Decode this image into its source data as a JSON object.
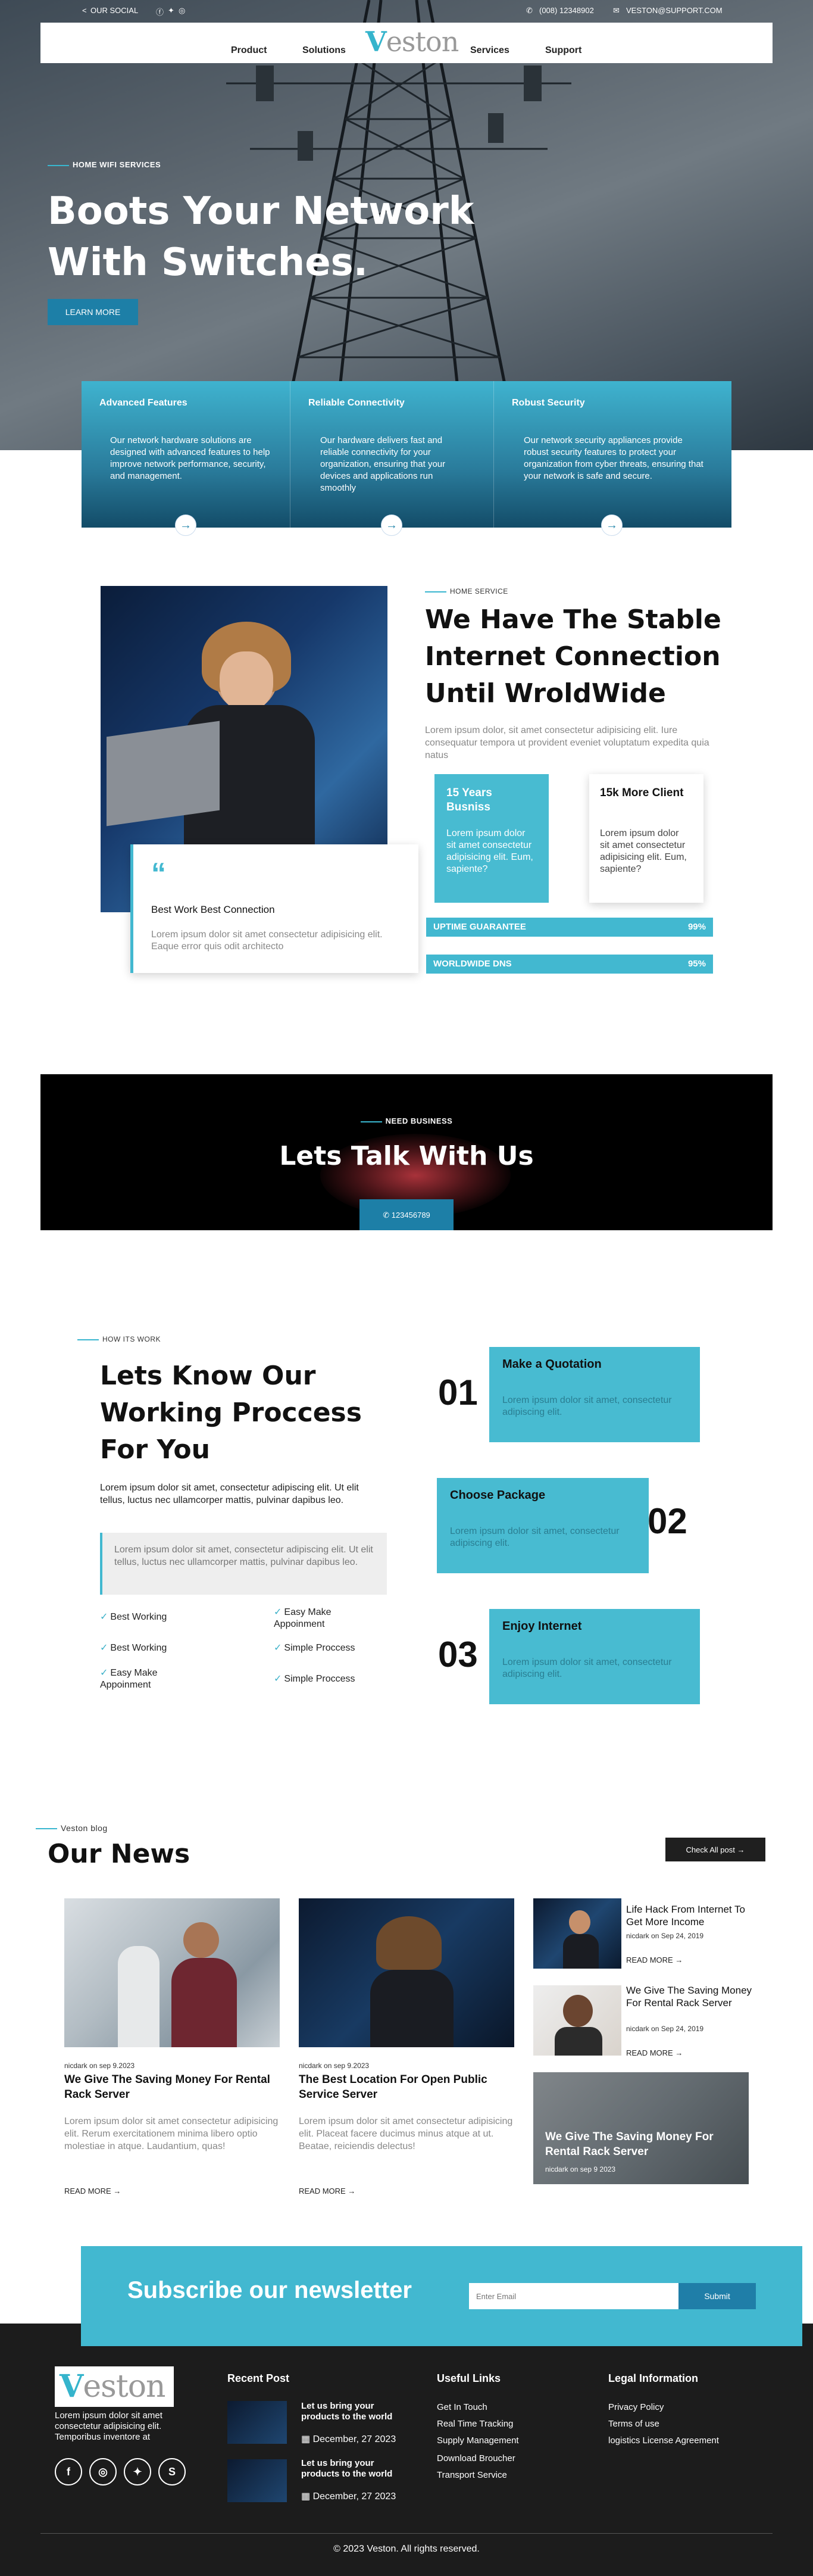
{
  "topbar": {
    "social": "OUR SOCIAL",
    "phone": "(008) 12348902",
    "email": "VESTON@SUPPORT.COM"
  },
  "nav": {
    "logo_first": "V",
    "logo_rest": "eston",
    "items": [
      "Product",
      "Solutions",
      "Services",
      "Support"
    ]
  },
  "hero": {
    "eyebrow": "HOME WIFI SERVICES",
    "title_line1": "Boots Your Network",
    "title_line2": "With Switches.",
    "cta": "LEARN MORE"
  },
  "features": [
    {
      "title": "Advanced Features",
      "text": "Our network hardware solutions are designed with advanced features to help improve network performance, security, and management."
    },
    {
      "title": "Reliable Connectivity",
      "text": "Our hardware delivers fast and reliable connectivity for your organization, ensuring that your devices and applications run smoothly"
    },
    {
      "title": "Robust Security",
      "text": "Our network security appliances provide robust security features to protect your organization from cyber threats, ensuring that your network is safe and secure."
    }
  ],
  "about": {
    "eyebrow": "Home Service",
    "title": "We Have The Stable Internet Connection Until WroldWide",
    "text": "Lorem ipsum dolor, sit amet consectetur adipisicing elit. Iure consequatur tempora ut provident eveniet voluptatum expedita quia natus",
    "quote_title": "Best Work Best Connection",
    "quote_text": "Lorem ipsum dolor sit amet consectetur adipisicing elit. Eaque error quis odit architecto",
    "stat1_title": "15 Years Busniss",
    "stat1_text": "Lorem ipsum dolor sit amet consectetur adipisicing elit. Eum, sapiente?",
    "stat2_title": "15k More Client",
    "stat2_text": "Lorem ipsum dolor sit amet consectetur adipisicing elit. Eum, sapiente?",
    "bars": [
      {
        "label": "UPTIME GUARANTEE",
        "value": "99%"
      },
      {
        "label": "WORLDWIDE DNS",
        "value": "95%"
      }
    ]
  },
  "cta": {
    "eyebrow": "NEED BUSINESS",
    "title": "Lets Talk With Us",
    "phone": "123456789"
  },
  "process": {
    "eyebrow": "HOW ITS WORK",
    "title": "Lets Know Our Working Proccess For You",
    "text": "Lorem ipsum dolor sit amet, consectetur adipiscing elit. Ut elit tellus, luctus nec ullamcorper mattis, pulvinar dapibus leo.",
    "quote": "Lorem ipsum dolor sit amet, consectetur adipiscing elit. Ut elit tellus, luctus nec ullamcorper mattis, pulvinar dapibus leo.",
    "checks": [
      "Best Working",
      "Easy Make Appoinment",
      "Best Working",
      "Simple Proccess",
      "Easy Make Appoinment",
      "Simple Proccess"
    ],
    "steps": [
      {
        "num": "01",
        "title": "Make a Quotation",
        "text": "Lorem ipsum dolor sit amet, consectetur adipiscing elit."
      },
      {
        "num": "02",
        "title": "Choose Package",
        "text": "Lorem ipsum dolor sit amet, consectetur adipiscing elit."
      },
      {
        "num": "03",
        "title": "Enjoy Internet",
        "text": "Lorem ipsum dolor sit amet, consectetur adipiscing elit."
      }
    ]
  },
  "blog": {
    "eyebrow": "Veston blog",
    "title": "Our News",
    "check_all": "Check All post",
    "main": [
      {
        "meta": "nicdark on sep 9.2023",
        "title": "We Give The Saving Money For Rental Rack Server",
        "text": "Lorem ipsum dolor sit amet consectetur adipisicing elit. Rerum exercitationem minima libero optio molestiae in atque. Laudantium, quas!",
        "more": "READ MORE"
      },
      {
        "meta": "nicdark on sep 9.2023",
        "title": "The Best Location For Open Public Service Server",
        "text": "Lorem ipsum dolor sit amet consectetur adipisicing elit. Placeat facere ducimus minus atque at ut. Beatae, reiciendis delectus!",
        "more": "READ MORE"
      }
    ],
    "side": [
      {
        "title": "Life Hack From Internet To Get More Income",
        "meta": "nicdark on Sep 24, 2019",
        "more": "READ MORE"
      },
      {
        "title": "We Give The Saving Money For Rental Rack Server",
        "meta": "nicdark on Sep 24, 2019",
        "more": "READ MORE"
      }
    ],
    "overlay": {
      "title": "We Give The Saving Money For Rental Rack Server",
      "meta": "nicdark on sep 9 2023"
    }
  },
  "newsletter": {
    "title": "Subscribe our newsletter",
    "placeholder": "Enter Email",
    "button": "Submit"
  },
  "footer": {
    "about": "Lorem ipsum dolor sit amet consectetur adipisicing elit. Temporibus inventore at",
    "recent_title": "Recent Post",
    "recent": [
      {
        "title": "Let us bring your products to the world",
        "date": "December, 27 2023"
      },
      {
        "title": "Let us bring your products to the world",
        "date": "December, 27 2023"
      }
    ],
    "useful_title": "Useful Links",
    "useful": [
      "Get In Touch",
      "Real Time Tracking",
      "Supply Management",
      "Download Broucher",
      "Transport Service"
    ],
    "legal_title": "Legal Information",
    "legal": [
      "Privacy Policy",
      "Terms of use",
      "logistics License Agreement"
    ],
    "copyright": "© 2023 Veston. All rights reserved."
  },
  "colors": {
    "accent": "#42b8d0",
    "dark": "#1c1c1c",
    "blue": "#1d7fa7"
  }
}
